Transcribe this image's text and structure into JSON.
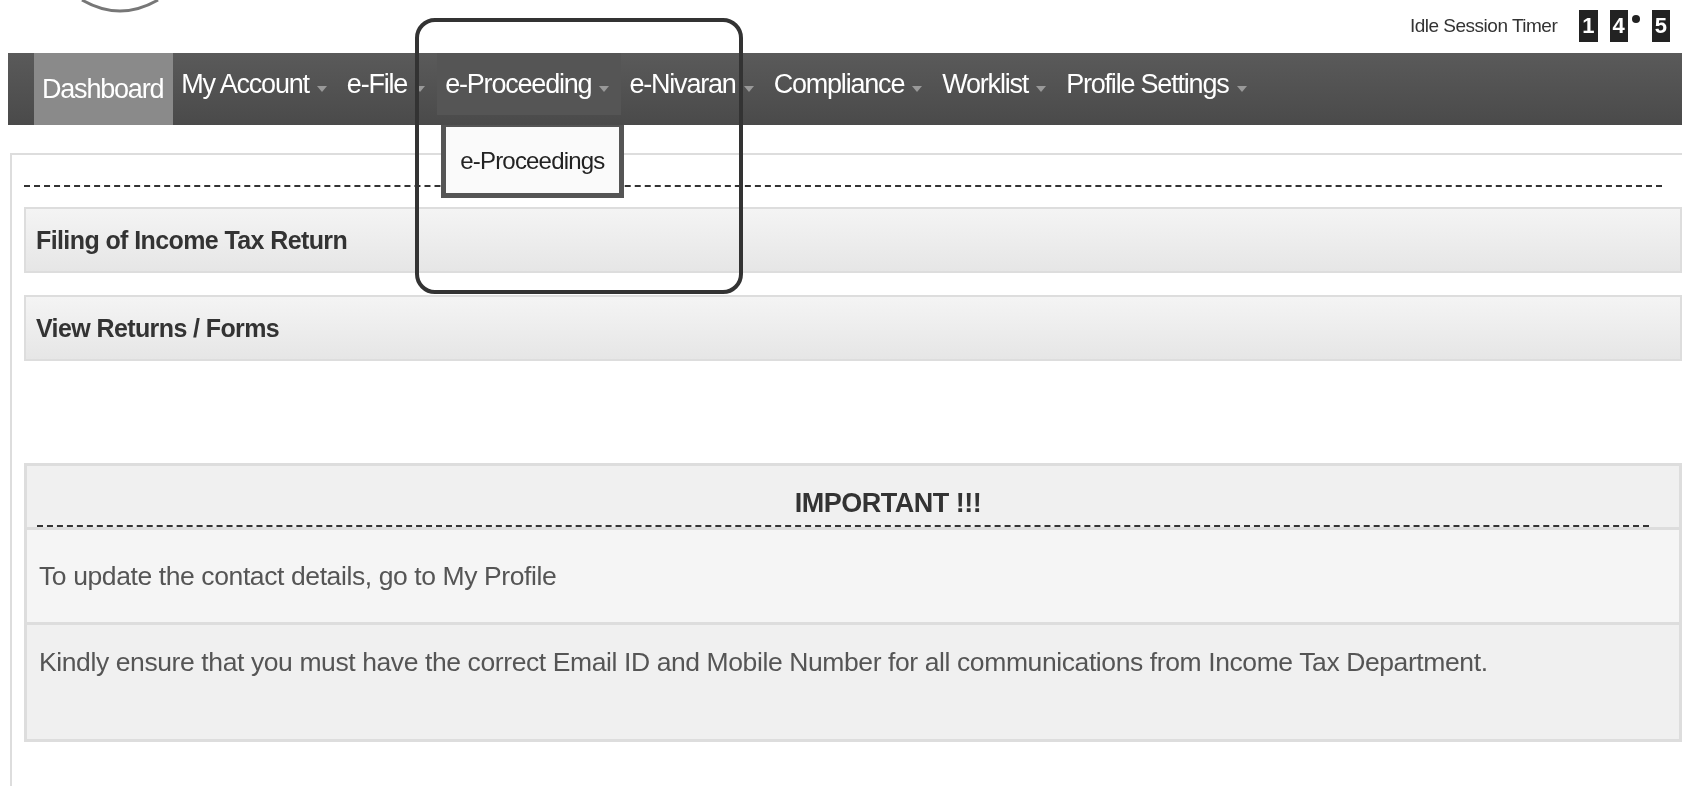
{
  "header": {
    "timer_label": "Idle Session Timer",
    "timer": [
      {
        "kind": "digit",
        "text": "1"
      },
      {
        "kind": "digit",
        "text": "4"
      },
      {
        "kind": "separator"
      },
      {
        "kind": "digit",
        "text": "5"
      }
    ]
  },
  "nav": [
    {
      "label": "Dashboard",
      "selected": true,
      "caret": false,
      "open": false
    },
    {
      "label": "My Account",
      "selected": false,
      "caret": true,
      "open": false
    },
    {
      "label": "e-File",
      "selected": false,
      "caret": true,
      "open": false
    },
    {
      "label": "e-Proceeding",
      "selected": false,
      "caret": true,
      "open": true,
      "menu": [
        "e-Proceedings"
      ]
    },
    {
      "label": "e-Nivaran",
      "selected": false,
      "caret": true,
      "open": false
    },
    {
      "label": "Compliance",
      "selected": false,
      "caret": true,
      "open": false
    },
    {
      "label": "Worklist",
      "selected": false,
      "caret": true,
      "open": false
    },
    {
      "label": "Profile Settings",
      "selected": false,
      "caret": true,
      "open": false
    }
  ],
  "sections": [
    "Filing of Income Tax Return",
    "View Returns / Forms"
  ],
  "important": {
    "title": "IMPORTANT !!!",
    "messages": [
      "To update the contact details, go to My Profile",
      "Kindly ensure that you must have the correct Email ID and Mobile Number for all communications from Income Tax Department."
    ]
  }
}
